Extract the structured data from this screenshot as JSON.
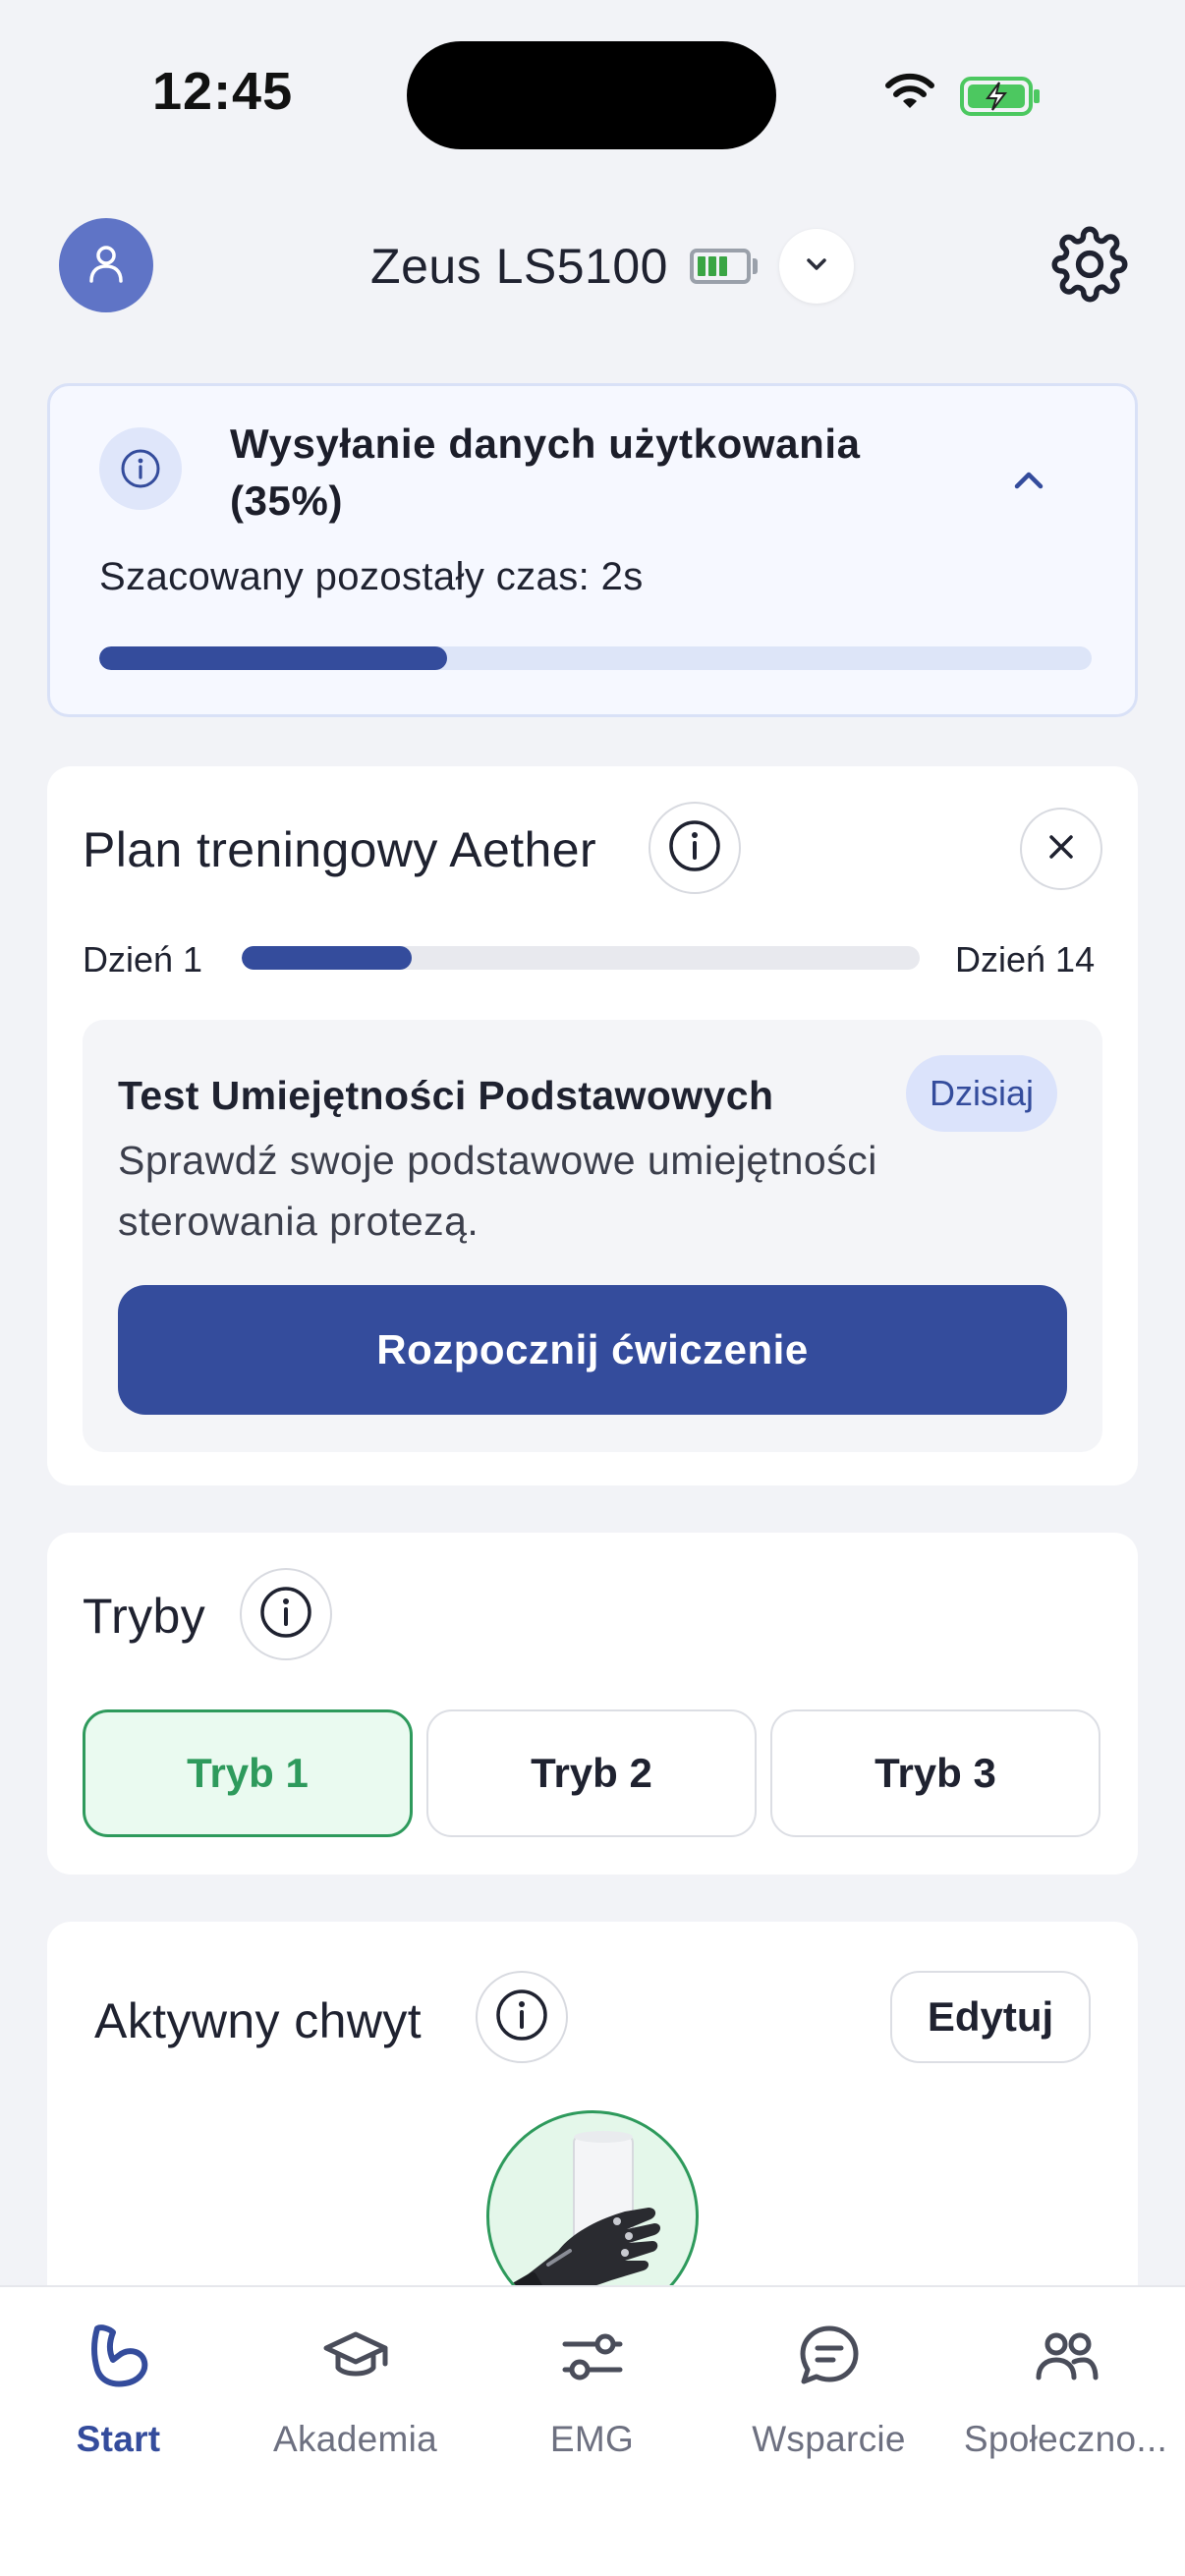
{
  "status_bar": {
    "time": "12:45"
  },
  "header": {
    "device_name": "Zeus LS5100",
    "icons": [
      "user-icon",
      "battery-icon",
      "chevron-down-icon",
      "gear-icon"
    ]
  },
  "upload": {
    "title": "Wysyłanie danych użytkowania (35%)",
    "eta": "Szacowany pozostały czas: 2s",
    "progress": 0.35
  },
  "training_plan": {
    "title": "Plan treningowy Aether",
    "day_start": "Dzień 1",
    "day_end": "Dzień 14",
    "progress": 0.25,
    "task": {
      "title": "Test Umiejętności Podstawowych",
      "badge": "Dzisiaj",
      "description": "Sprawdź swoje podstawowe umiejętności sterowania protezą.",
      "button": "Rozpocznij ćwiczenie"
    }
  },
  "modes": {
    "title": "Tryby",
    "items": [
      {
        "label": "Tryb 1",
        "active": true
      },
      {
        "label": "Tryb 2",
        "active": false
      },
      {
        "label": "Tryb 3",
        "active": false
      }
    ]
  },
  "active_grip": {
    "title": "Aktywny chwyt",
    "edit_label": "Edytuj"
  },
  "bottom_nav": {
    "items": [
      {
        "label": "Start",
        "icon": "arm-icon",
        "active": true
      },
      {
        "label": "Akademia",
        "icon": "graduation-cap-icon",
        "active": false
      },
      {
        "label": "EMG",
        "icon": "sliders-icon",
        "active": false
      },
      {
        "label": "Wsparcie",
        "icon": "chat-icon",
        "active": false
      },
      {
        "label": "Społeczno...",
        "icon": "people-icon",
        "active": false
      }
    ]
  },
  "colors": {
    "primary": "#344c9c",
    "success": "#2e9a5c",
    "background": "#f2f3f7",
    "avatar": "#5f74c6"
  }
}
